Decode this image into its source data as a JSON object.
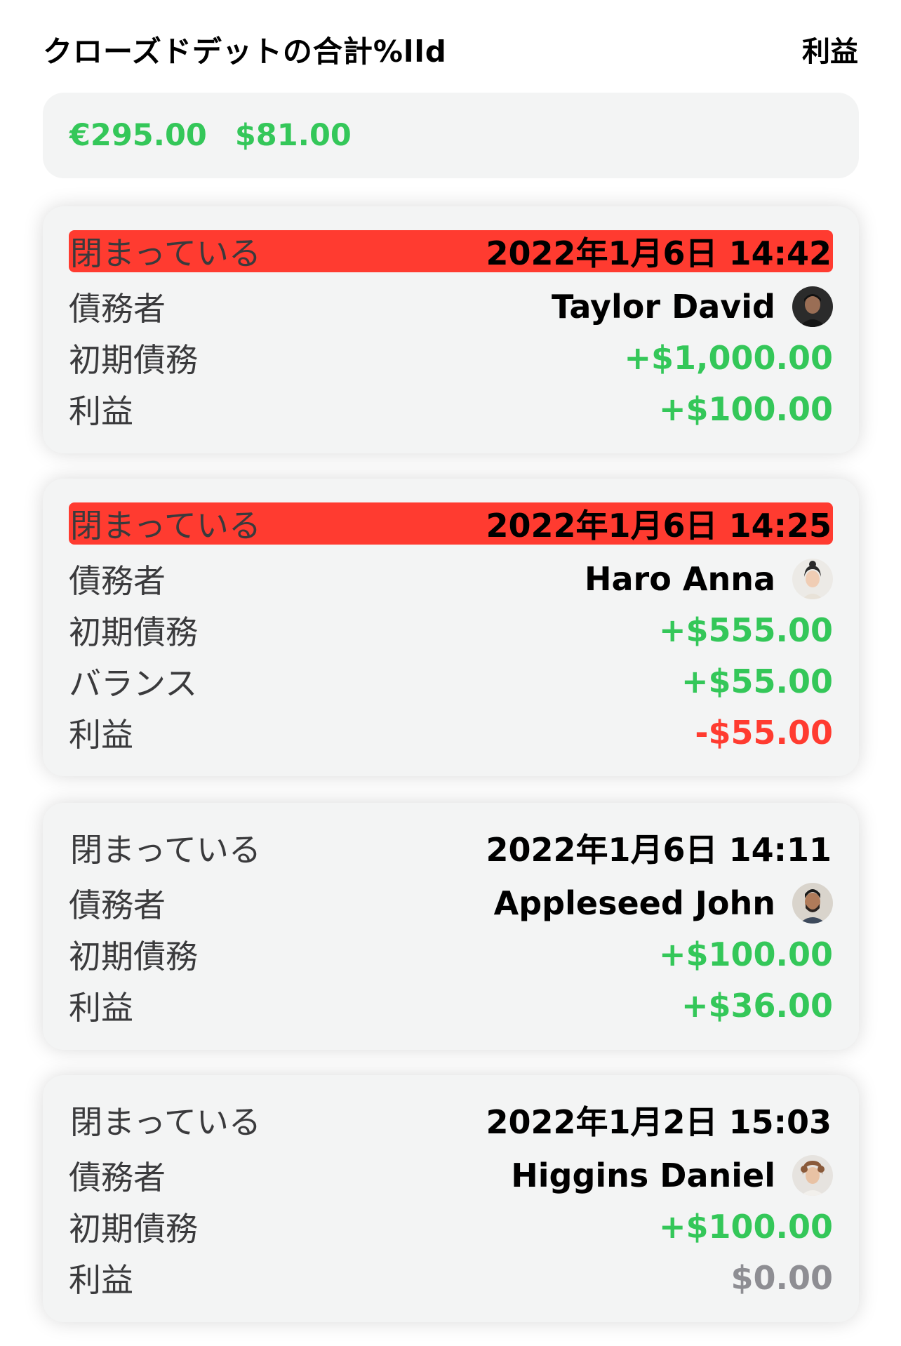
{
  "header": {
    "title": "クローズドデットの合計%lld",
    "right_label": "利益"
  },
  "totals": [
    "€295.00",
    "$81.00"
  ],
  "colors": {
    "green": "#34c759",
    "red": "#ff3b30",
    "gray": "#8e8e93"
  },
  "debts": [
    {
      "status": "閉まっている",
      "date": "2022年1月6日 14:42",
      "highlight": true,
      "debtor_label": "債務者",
      "debtor": "Taylor David",
      "avatar": "avatar-dark-male",
      "rows": [
        {
          "label": "初期債務",
          "value": "+$1,000.00",
          "tone": "green"
        },
        {
          "label": "利益",
          "value": "+$100.00",
          "tone": "green"
        }
      ]
    },
    {
      "status": "閉まっている",
      "date": "2022年1月6日 14:25",
      "highlight": true,
      "debtor_label": "債務者",
      "debtor": "Haro Anna",
      "avatar": "avatar-female",
      "rows": [
        {
          "label": "初期債務",
          "value": "+$555.00",
          "tone": "green"
        },
        {
          "label": "バランス",
          "value": "+$55.00",
          "tone": "green"
        },
        {
          "label": "利益",
          "value": "-$55.00",
          "tone": "red"
        }
      ]
    },
    {
      "status": "閉まっている",
      "date": "2022年1月6日 14:11",
      "highlight": false,
      "debtor_label": "債務者",
      "debtor": "Appleseed John",
      "avatar": "avatar-bearded-male",
      "rows": [
        {
          "label": "初期債務",
          "value": "+$100.00",
          "tone": "green"
        },
        {
          "label": "利益",
          "value": "+$36.00",
          "tone": "green"
        }
      ]
    },
    {
      "status": "閉まっている",
      "date": "2022年1月2日 15:03",
      "highlight": false,
      "debtor_label": "債務者",
      "debtor": "Higgins Daniel",
      "avatar": "avatar-curly-male",
      "rows": [
        {
          "label": "初期債務",
          "value": "+$100.00",
          "tone": "green"
        },
        {
          "label": "利益",
          "value": "$0.00",
          "tone": "gray"
        }
      ]
    }
  ]
}
